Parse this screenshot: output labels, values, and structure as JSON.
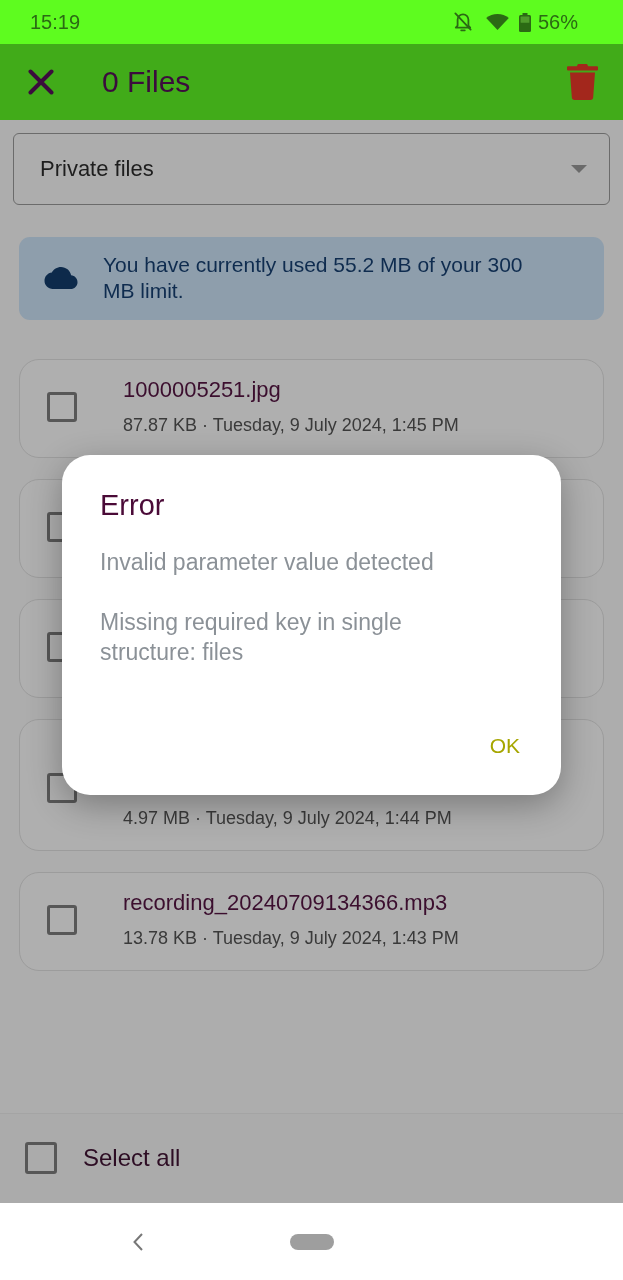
{
  "status_bar": {
    "time": "15:19",
    "battery": "56%"
  },
  "app_bar": {
    "title": "0 Files"
  },
  "folder_select": {
    "value": "Private files"
  },
  "storage_notice": {
    "text": "You have currently used 55.2 MB of your 300 MB limit."
  },
  "files": [
    {
      "name": "1000005251.jpg",
      "meta": "87.87 KB · Tuesday, 9 July 2024, 1:45 PM",
      "checked": false
    },
    {
      "checked": false
    },
    {
      "checked": false
    },
    {
      "meta": "4.97 MB · Tuesday, 9 July 2024, 1:44 PM",
      "checked": false
    },
    {
      "name": "recording_20240709134366.mp3",
      "meta": "13.78 KB · Tuesday, 9 July 2024, 1:43 PM",
      "checked": false
    }
  ],
  "select_all": {
    "label": "Select all",
    "checked": false
  },
  "dialog": {
    "title": "Error",
    "messages": [
      "Invalid parameter value detected",
      "Missing required key in single structure: files"
    ],
    "button": "OK"
  }
}
